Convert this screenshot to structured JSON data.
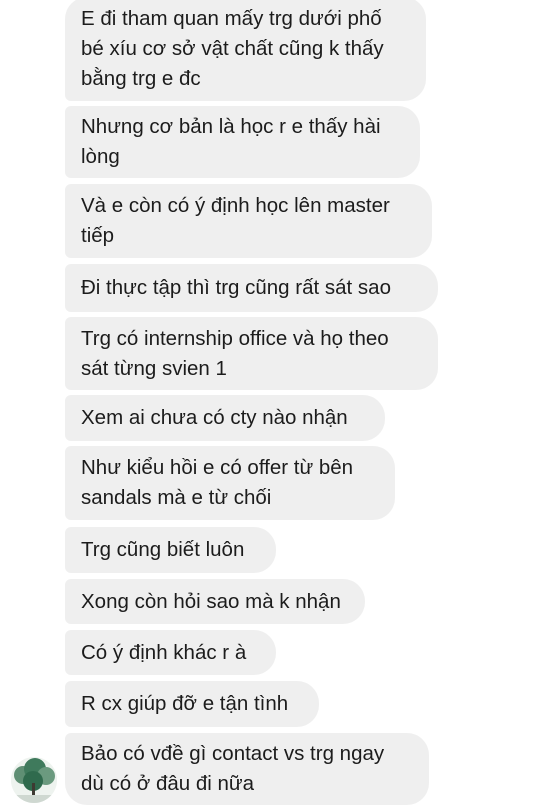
{
  "conversation": {
    "messages": [
      {
        "text": "E đi tham quan mấy trg dưới phố\nbé xíu cơ sở vật chất cũng k thấy\nbằng trg e đc"
      },
      {
        "text": "Nhưng cơ bản là học r e thấy hài\nlòng"
      },
      {
        "text": "Và e còn có ý định học lên master\ntiếp"
      },
      {
        "text": "Đi thực tập thì trg cũng rất sát sao"
      },
      {
        "text": "Trg có internship office và họ theo\nsát từng svien 1"
      },
      {
        "text": "Xem ai chưa có cty nào nhận"
      },
      {
        "text": "Như kiểu hồi e có offer từ bên\nsandals mà e từ chối"
      },
      {
        "text": "Trg cũng biết luôn"
      },
      {
        "text": "Xong còn hỏi sao mà k nhận"
      },
      {
        "text": "Có ý định khác r à"
      },
      {
        "text": "R cx giúp đỡ e tận tình"
      },
      {
        "text": "Bảo có vđề gì contact vs trg ngay\ndù có ở đâu đi nữa"
      }
    ],
    "sender": {
      "avatar_icon": "tree-avatar-icon"
    },
    "colors": {
      "bubble": "#efefef",
      "text": "#1c1c1c",
      "background": "#ffffff"
    }
  }
}
